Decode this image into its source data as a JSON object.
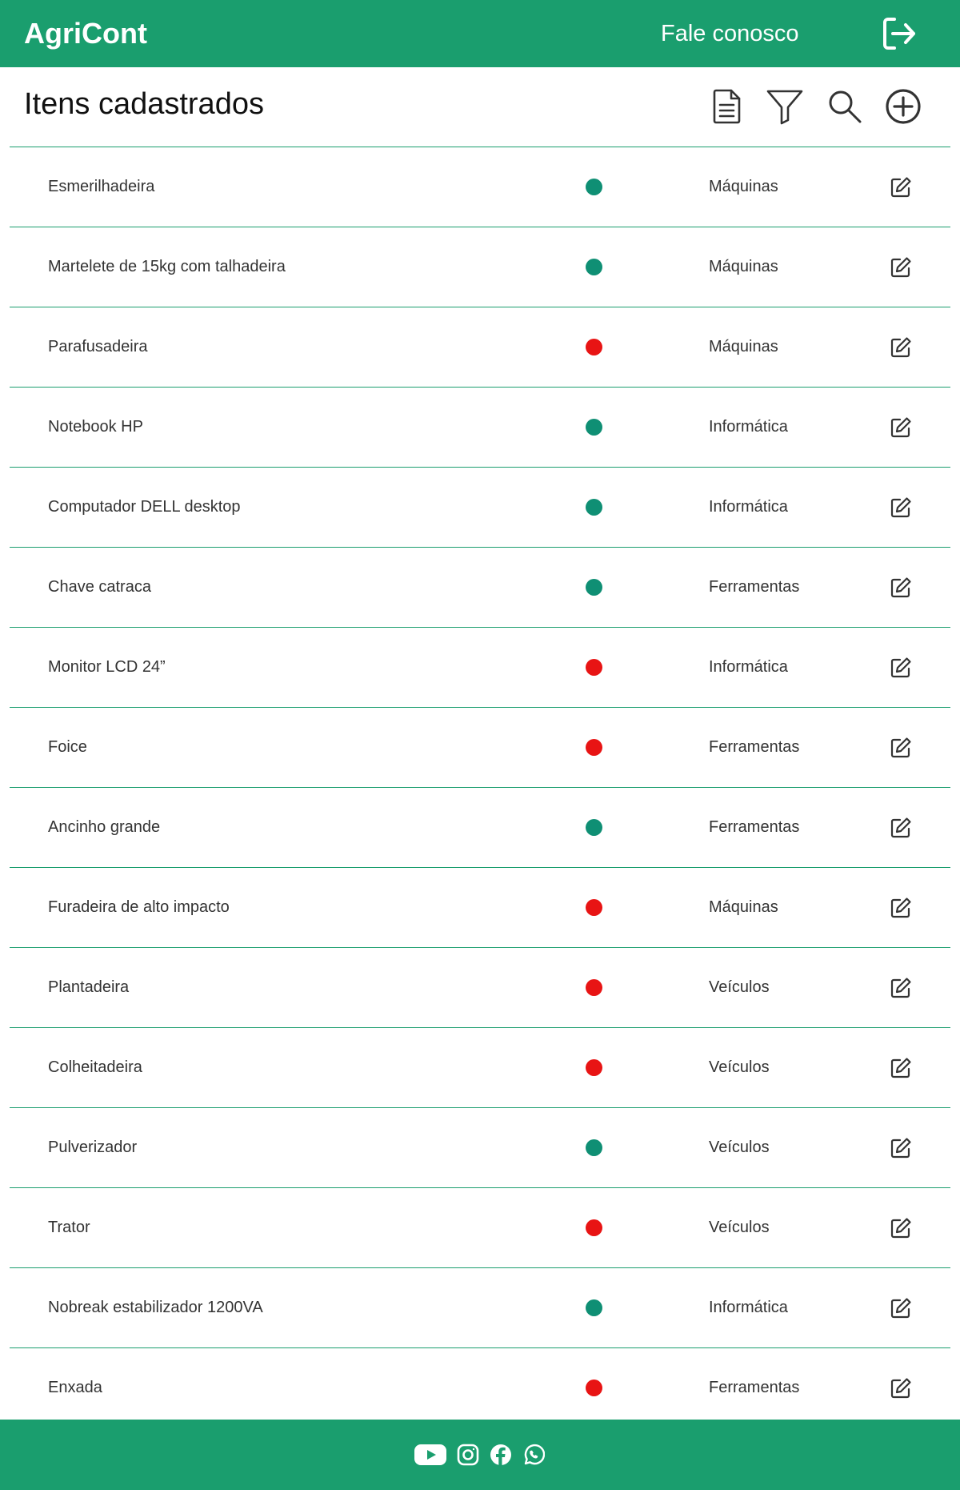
{
  "header": {
    "brand": "AgriCont",
    "contact_label": "Fale conosco",
    "logout_icon": "logout-icon"
  },
  "page": {
    "title": "Itens cadastrados"
  },
  "toolbar": {
    "icons": [
      "report-icon",
      "filter-icon",
      "search-icon",
      "add-icon"
    ]
  },
  "status_colors": {
    "available": "#0f8f74",
    "unavailable": "#e81414"
  },
  "items": [
    {
      "name": "Esmerilhadeira",
      "status": "available",
      "category": "Máquinas"
    },
    {
      "name": "Martelete de 15kg com talhadeira",
      "status": "available",
      "category": "Máquinas"
    },
    {
      "name": "Parafusadeira",
      "status": "unavailable",
      "category": "Máquinas"
    },
    {
      "name": "Notebook HP",
      "status": "available",
      "category": "Informática"
    },
    {
      "name": "Computador DELL desktop",
      "status": "available",
      "category": "Informática"
    },
    {
      "name": "Chave catraca",
      "status": "available",
      "category": "Ferramentas"
    },
    {
      "name": "Monitor LCD 24”",
      "status": "unavailable",
      "category": "Informática"
    },
    {
      "name": "Foice",
      "status": "unavailable",
      "category": "Ferramentas"
    },
    {
      "name": "Ancinho grande",
      "status": "available",
      "category": "Ferramentas"
    },
    {
      "name": "Furadeira de alto impacto",
      "status": "unavailable",
      "category": "Máquinas"
    },
    {
      "name": "Plantadeira",
      "status": "unavailable",
      "category": "Veículos"
    },
    {
      "name": "Colheitadeira",
      "status": "unavailable",
      "category": "Veículos"
    },
    {
      "name": "Pulverizador",
      "status": "available",
      "category": "Veículos"
    },
    {
      "name": "Trator",
      "status": "unavailable",
      "category": "Veículos"
    },
    {
      "name": "Nobreak estabilizador 1200VA",
      "status": "available",
      "category": "Informática"
    },
    {
      "name": "Enxada",
      "status": "unavailable",
      "category": "Ferramentas"
    }
  ],
  "footer": {
    "social_icons": [
      "youtube-icon",
      "instagram-icon",
      "facebook-icon",
      "whatsapp-icon"
    ]
  },
  "theme": {
    "primary": "#1a9e6e"
  }
}
